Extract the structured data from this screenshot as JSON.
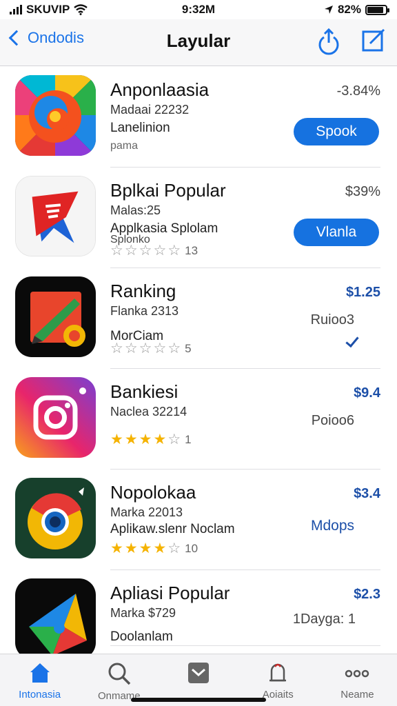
{
  "status": {
    "carrier": "SKUVIP",
    "time": "9:32M",
    "battery": "82%"
  },
  "nav": {
    "back_label": "Ondodis",
    "title": "Layular"
  },
  "apps": [
    {
      "name": "Anponlaasia",
      "sub1": "Madaai 22232",
      "sub2": "Lanelinion",
      "sub3": "pama",
      "price": "-3.84%",
      "button": "Spook",
      "icon": "colorful-swirl-icon"
    },
    {
      "name": "Bplkai Popular",
      "sub1": "Malas:25",
      "sub2": "Applkasia Splolam",
      "sub3": "Splonko",
      "price": "$39%",
      "button": "Vlanla",
      "stars": 0,
      "rating_count": "13",
      "icon": "red-ribbon-icon"
    },
    {
      "name": "Ranking",
      "sub1": "Flanka 2313",
      "sub2": "MorCiam",
      "price": "$1.25",
      "rank": "Ruioo3",
      "stars": 0,
      "rating_count": "5",
      "icon": "pen-tool-icon"
    },
    {
      "name": "Bankiesi",
      "sub1": "Naclea 32214",
      "price": "$9.4",
      "rank": "Poioo6",
      "stars": 3.5,
      "rating_count": "1",
      "icon": "instagram-camera-icon"
    },
    {
      "name": "Nopolokaa",
      "sub1": "Marka 22013",
      "sub2": "Aplikaw.slenr Noclam",
      "price": "$3.4",
      "label": "Mdops",
      "stars": 4,
      "rating_count": "10",
      "icon": "chrome-browser-icon"
    },
    {
      "name": "Apliasi Popular",
      "sub1": "Marka $729",
      "sub2": "Doolanlam",
      "price": "$2.3",
      "rank": "1Dayga: 1",
      "icon": "google-play-icon"
    }
  ],
  "tabs": [
    {
      "label": "Intonasia",
      "icon": "home-icon",
      "active": true
    },
    {
      "label": "Onmame",
      "icon": "search-icon"
    },
    {
      "label": "",
      "icon": "inbox-icon"
    },
    {
      "label": "Aoiaits",
      "icon": "bell-icon"
    },
    {
      "label": "Neame",
      "icon": "more-icon"
    }
  ],
  "colors": {
    "accent": "#1672e0",
    "price_blue": "#1c4fa8",
    "star": "#f5b301"
  }
}
